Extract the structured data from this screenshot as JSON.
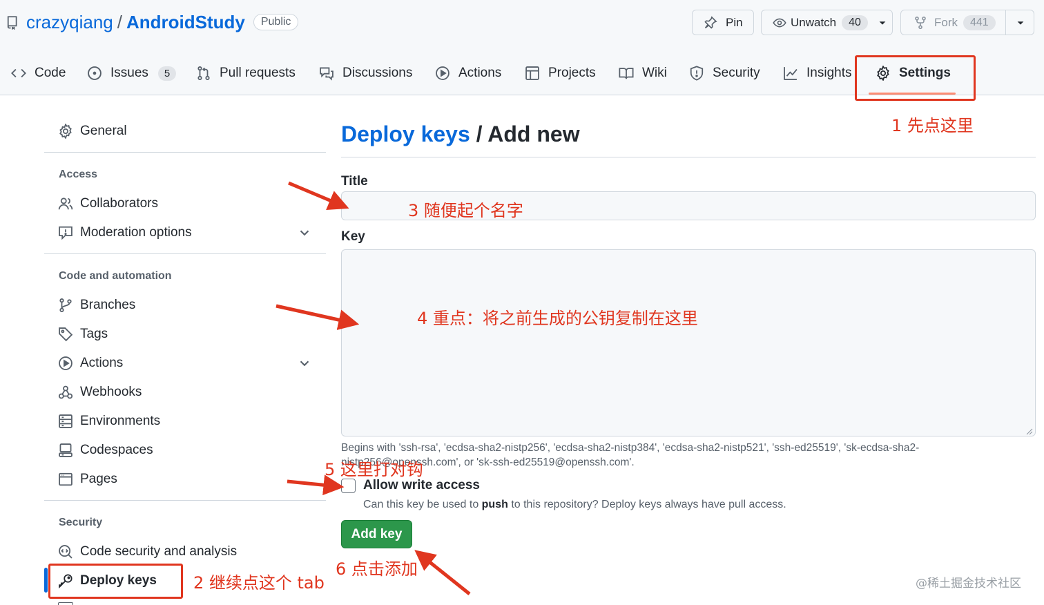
{
  "repo": {
    "owner": "crazyqiang",
    "separator": "/",
    "name": "AndroidStudy",
    "visibility": "Public"
  },
  "header_buttons": {
    "pin_label": "Pin",
    "unwatch_label": "Unwatch",
    "watch_count": "40",
    "fork_label": "Fork",
    "fork_count": "441"
  },
  "nav": {
    "tabs": [
      {
        "label": "Code",
        "icon": "code-icon"
      },
      {
        "label": "Issues",
        "icon": "issue-icon",
        "count": "5"
      },
      {
        "label": "Pull requests",
        "icon": "pull-request-icon"
      },
      {
        "label": "Discussions",
        "icon": "discussion-icon"
      },
      {
        "label": "Actions",
        "icon": "play-icon"
      },
      {
        "label": "Projects",
        "icon": "table-icon"
      },
      {
        "label": "Wiki",
        "icon": "book-icon"
      },
      {
        "label": "Security",
        "icon": "shield-icon"
      },
      {
        "label": "Insights",
        "icon": "graph-icon"
      },
      {
        "label": "Settings",
        "icon": "gear-icon",
        "selected": true
      }
    ]
  },
  "sidebar": {
    "general": "General",
    "access_heading": "Access",
    "collaborators": "Collaborators",
    "moderation": "Moderation options",
    "code_heading": "Code and automation",
    "branches": "Branches",
    "tags": "Tags",
    "actions": "Actions",
    "webhooks": "Webhooks",
    "environments": "Environments",
    "codespaces": "Codespaces",
    "pages": "Pages",
    "security_heading": "Security",
    "code_security": "Code security and analysis",
    "deploy_keys": "Deploy keys"
  },
  "main": {
    "title_link": "Deploy keys",
    "title_rest": " / Add new",
    "title_label": "Title",
    "title_value": "",
    "key_label": "Key",
    "key_value": "",
    "key_hint": "Begins with 'ssh-rsa', 'ecdsa-sha2-nistp256', 'ecdsa-sha2-nistp384', 'ecdsa-sha2-nistp521', 'ssh-ed25519', 'sk-ecdsa-sha2-nistp256@openssh.com', or 'sk-ssh-ed25519@openssh.com'.",
    "allow_write_label": "Allow write access",
    "allow_write_checked": false,
    "allow_write_note_pre": "Can this key be used to ",
    "allow_write_note_bold": "push",
    "allow_write_note_post": " to this repository? Deploy keys always have pull access.",
    "add_key_button": "Add key"
  },
  "annotations": {
    "step1": "1 先点这里",
    "step2": "2 继续点这个 tab",
    "step3": "3 随便起个名字",
    "step4": "4 重点：将之前生成的公钥复制在这里",
    "step5": "5 这里打对钩",
    "step6": "6 点击添加",
    "color": "#e0361f"
  },
  "watermark": "@稀土掘金技术社区",
  "colors": {
    "link": "#0969da",
    "primary_button": "#2c974b",
    "selected_underline": "#fd8c73",
    "active_sidebar": "#0969da"
  }
}
